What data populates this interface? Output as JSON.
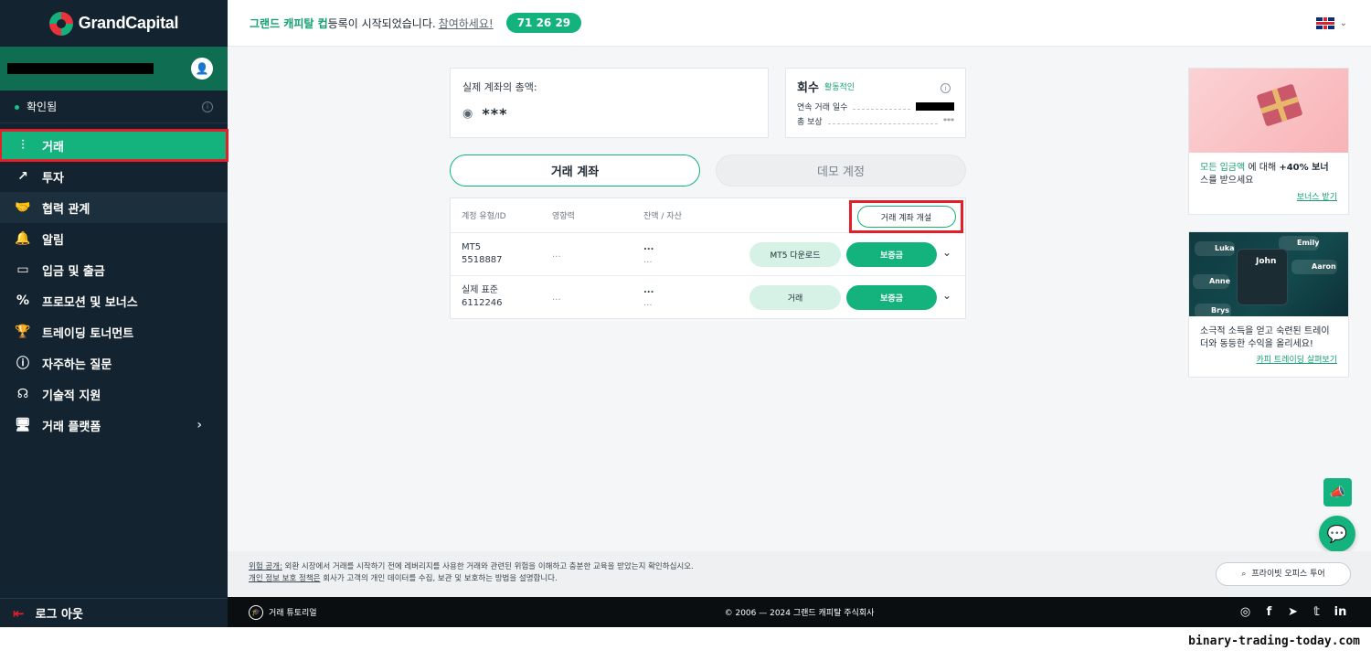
{
  "brand": {
    "name": "GrandCapital",
    "accent": "#14b37e",
    "sidebar_bg": "#13232f"
  },
  "sidebar": {
    "verification": "확인됨",
    "items": [
      {
        "label": "거래",
        "icon": "candles-icon",
        "active": true
      },
      {
        "label": "투자",
        "icon": "trend-icon"
      },
      {
        "label": "협력 관계",
        "icon": "handshake-icon"
      },
      {
        "label": "알림",
        "icon": "bell-icon"
      },
      {
        "label": "입금 및 출금",
        "icon": "wallet-icon"
      },
      {
        "label": "프로모션 및 보너스",
        "icon": "percent-icon"
      },
      {
        "label": "트레이딩 토너먼트",
        "icon": "trophy-icon"
      },
      {
        "label": "자주하는 질문",
        "icon": "info-icon"
      },
      {
        "label": "기술적 지원",
        "icon": "headset-icon"
      },
      {
        "label": "거래 플랫폼",
        "icon": "monitor-icon"
      }
    ],
    "logout": "로그 아웃"
  },
  "topbar": {
    "promo_name": "그랜드 캐피탈 컵",
    "promo_text": " 등록이 시작되었습니다.",
    "promo_link": "참여하세요!",
    "timer": "71 26 29"
  },
  "summary": {
    "total_label": "실제 계좌의 총액:",
    "total_value": "***",
    "loyalty_title": "회수",
    "loyalty_status": "활동적인",
    "streak_label": "연속 거래 일수",
    "reward_label": "총 보상",
    "reward_value": "***"
  },
  "tabs": {
    "live": "거래 계좌",
    "demo": "데모 계정"
  },
  "table": {
    "headers": [
      "계정 유형/ID",
      "영향력",
      "잔액 / 자산"
    ],
    "open_button": "거래 계좌 개설",
    "rows": [
      {
        "type": "MT5",
        "id": "5518887",
        "leverage": "...",
        "balance": "...",
        "assets": "...",
        "action": "MT5 다운로드",
        "deposit": "보증금"
      },
      {
        "type": "실제 표준",
        "id": "6112246",
        "leverage": "...",
        "balance": "...",
        "assets": "...",
        "action": "거래",
        "deposit": "보증금"
      }
    ]
  },
  "promos": {
    "bonus_hl": "모든 입금액",
    "bonus_mid": " 에 대해 ",
    "bonus_bold": "+40% 보너",
    "bonus_rest": "스를 받으세요",
    "bonus_link": "보너스 받기",
    "copy_text": "소극적 소득을 얻고 숙련된 트레이더와 동등한 수익을 올리세요!",
    "copy_link": "카피 트레이딩 살펴보기",
    "copy_names": [
      "Luka",
      "Emily",
      "John",
      "Aaron",
      "Anne",
      "Brys"
    ]
  },
  "disclaimer": {
    "risk_link": "위험 공개:",
    "risk_text": " 외환 시장에서 거래를 시작하기 전에 레버리지를 사용한 거래와 관련된 위험을 이해하고 충분한 교육을 받았는지 확인하십시오.",
    "privacy_link": "개인 정보 보호 정책은",
    "privacy_text": " 회사가 고객의 개인 데이터를 수집, 보관 및 보호하는 방법을 설명합니다.",
    "tour_button": "프라이빗 오피스 투어"
  },
  "footer": {
    "tutorial": "거래 튜토리얼",
    "copyright": "© 2006 — 2024 그랜드 캐피탈 주식회사",
    "social": [
      "instagram-icon",
      "facebook-icon",
      "telegram-icon",
      "twitter-icon",
      "linkedin-icon"
    ]
  },
  "watermark": "binary-trading-today.com"
}
